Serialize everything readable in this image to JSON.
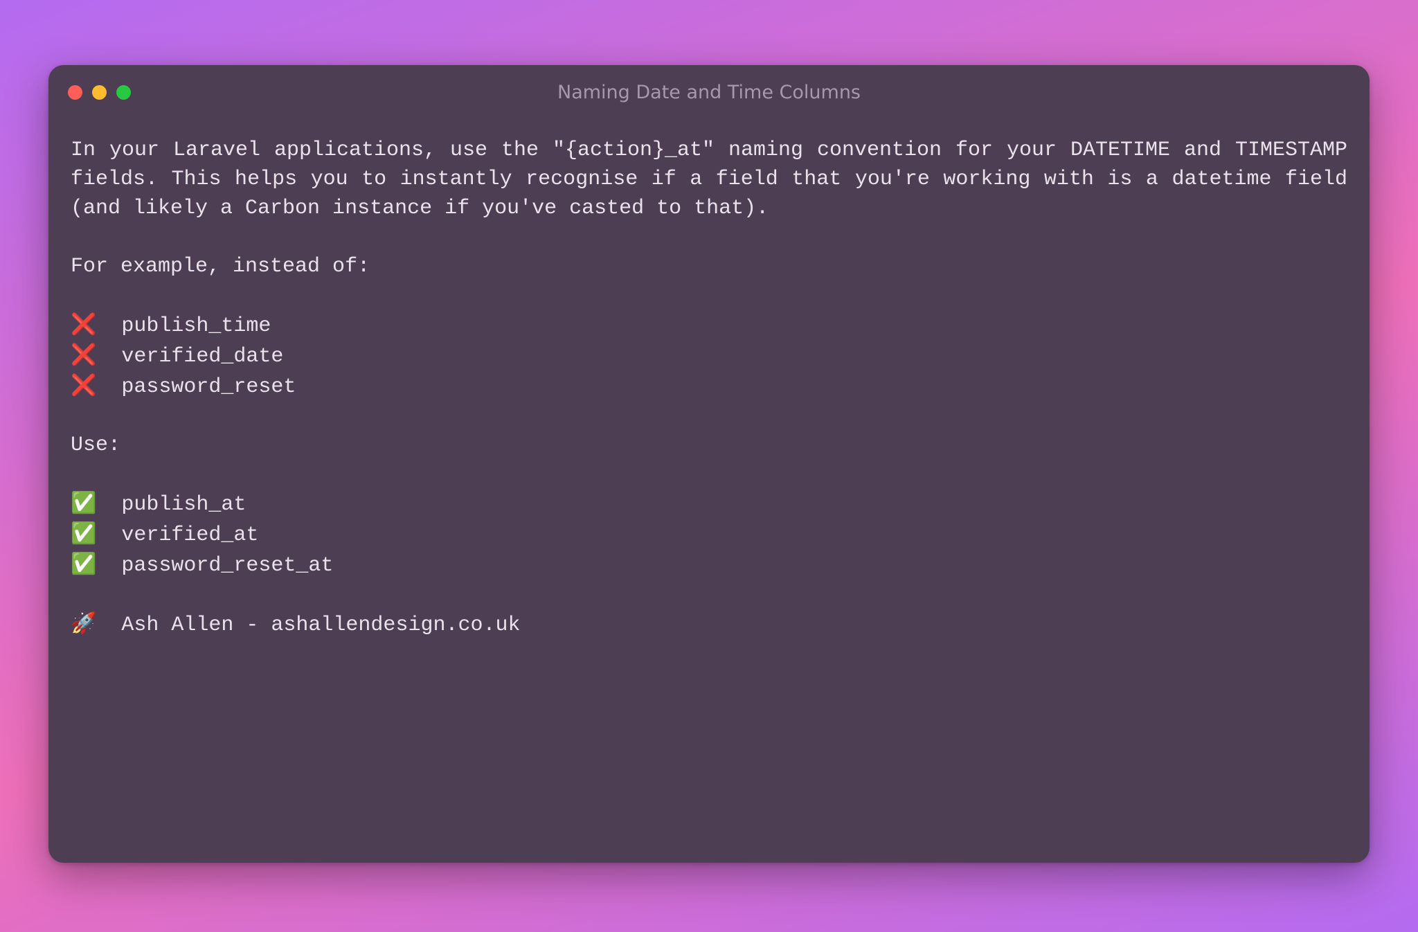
{
  "window": {
    "title": "Naming Date and Time Columns"
  },
  "body": {
    "intro_para": "In your Laravel applications, use the \"{action}_at\" naming convention for your DATETIME and TIMESTAMP fields. This helps you to instantly recognise if a field that you're working with is a datetime field (and likely a Carbon instance if you've casted to that).",
    "instead_of_label": "For example, instead of:",
    "bad_icon": "❌",
    "bad": [
      "publish_time",
      "verified_date",
      "password_reset"
    ],
    "use_label": "Use:",
    "good_icon": "✅",
    "good": [
      "publish_at",
      "verified_at",
      "password_reset_at"
    ],
    "attribution_icon": "🚀",
    "attribution": "Ash Allen - ashallendesign.co.uk"
  }
}
